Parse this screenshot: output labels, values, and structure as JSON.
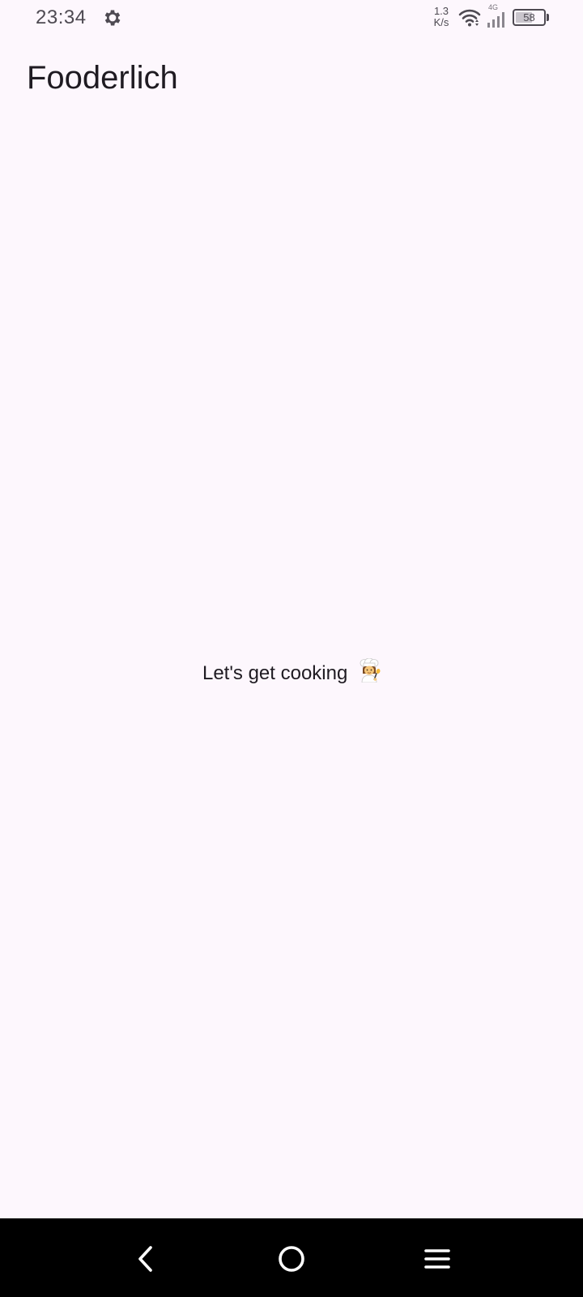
{
  "status_bar": {
    "time": "23:34",
    "settings_icon": "gear-icon",
    "net_speed_value": "1.3",
    "net_speed_unit": "K/s",
    "net_type": "4G",
    "battery_level": "58",
    "battery_fraction": 0.58
  },
  "app_bar": {
    "title": "Fooderlich"
  },
  "main": {
    "message": "Let's get cooking",
    "message_icon": "chef-emoji-icon"
  },
  "nav_bar": {
    "back_icon": "back-icon",
    "home_icon": "home-icon",
    "menu_icon": "menu-icon"
  },
  "colors": {
    "background": "#fdf7fd",
    "text": "#1f1b22",
    "nav_bar": "#000000"
  }
}
